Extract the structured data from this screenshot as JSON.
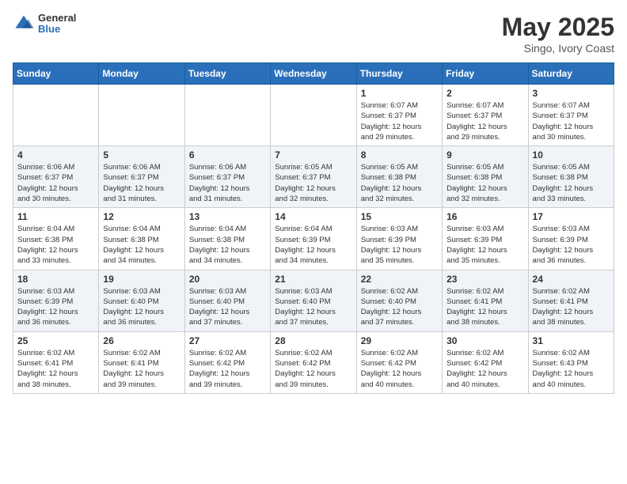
{
  "header": {
    "logo_general": "General",
    "logo_blue": "Blue",
    "month_year": "May 2025",
    "location": "Singo, Ivory Coast"
  },
  "days_of_week": [
    "Sunday",
    "Monday",
    "Tuesday",
    "Wednesday",
    "Thursday",
    "Friday",
    "Saturday"
  ],
  "weeks": [
    [
      {
        "day": "",
        "info": ""
      },
      {
        "day": "",
        "info": ""
      },
      {
        "day": "",
        "info": ""
      },
      {
        "day": "",
        "info": ""
      },
      {
        "day": "1",
        "info": "Sunrise: 6:07 AM\nSunset: 6:37 PM\nDaylight: 12 hours\nand 29 minutes."
      },
      {
        "day": "2",
        "info": "Sunrise: 6:07 AM\nSunset: 6:37 PM\nDaylight: 12 hours\nand 29 minutes."
      },
      {
        "day": "3",
        "info": "Sunrise: 6:07 AM\nSunset: 6:37 PM\nDaylight: 12 hours\nand 30 minutes."
      }
    ],
    [
      {
        "day": "4",
        "info": "Sunrise: 6:06 AM\nSunset: 6:37 PM\nDaylight: 12 hours\nand 30 minutes."
      },
      {
        "day": "5",
        "info": "Sunrise: 6:06 AM\nSunset: 6:37 PM\nDaylight: 12 hours\nand 31 minutes."
      },
      {
        "day": "6",
        "info": "Sunrise: 6:06 AM\nSunset: 6:37 PM\nDaylight: 12 hours\nand 31 minutes."
      },
      {
        "day": "7",
        "info": "Sunrise: 6:05 AM\nSunset: 6:37 PM\nDaylight: 12 hours\nand 32 minutes."
      },
      {
        "day": "8",
        "info": "Sunrise: 6:05 AM\nSunset: 6:38 PM\nDaylight: 12 hours\nand 32 minutes."
      },
      {
        "day": "9",
        "info": "Sunrise: 6:05 AM\nSunset: 6:38 PM\nDaylight: 12 hours\nand 32 minutes."
      },
      {
        "day": "10",
        "info": "Sunrise: 6:05 AM\nSunset: 6:38 PM\nDaylight: 12 hours\nand 33 minutes."
      }
    ],
    [
      {
        "day": "11",
        "info": "Sunrise: 6:04 AM\nSunset: 6:38 PM\nDaylight: 12 hours\nand 33 minutes."
      },
      {
        "day": "12",
        "info": "Sunrise: 6:04 AM\nSunset: 6:38 PM\nDaylight: 12 hours\nand 34 minutes."
      },
      {
        "day": "13",
        "info": "Sunrise: 6:04 AM\nSunset: 6:38 PM\nDaylight: 12 hours\nand 34 minutes."
      },
      {
        "day": "14",
        "info": "Sunrise: 6:04 AM\nSunset: 6:39 PM\nDaylight: 12 hours\nand 34 minutes."
      },
      {
        "day": "15",
        "info": "Sunrise: 6:03 AM\nSunset: 6:39 PM\nDaylight: 12 hours\nand 35 minutes."
      },
      {
        "day": "16",
        "info": "Sunrise: 6:03 AM\nSunset: 6:39 PM\nDaylight: 12 hours\nand 35 minutes."
      },
      {
        "day": "17",
        "info": "Sunrise: 6:03 AM\nSunset: 6:39 PM\nDaylight: 12 hours\nand 36 minutes."
      }
    ],
    [
      {
        "day": "18",
        "info": "Sunrise: 6:03 AM\nSunset: 6:39 PM\nDaylight: 12 hours\nand 36 minutes."
      },
      {
        "day": "19",
        "info": "Sunrise: 6:03 AM\nSunset: 6:40 PM\nDaylight: 12 hours\nand 36 minutes."
      },
      {
        "day": "20",
        "info": "Sunrise: 6:03 AM\nSunset: 6:40 PM\nDaylight: 12 hours\nand 37 minutes."
      },
      {
        "day": "21",
        "info": "Sunrise: 6:03 AM\nSunset: 6:40 PM\nDaylight: 12 hours\nand 37 minutes."
      },
      {
        "day": "22",
        "info": "Sunrise: 6:02 AM\nSunset: 6:40 PM\nDaylight: 12 hours\nand 37 minutes."
      },
      {
        "day": "23",
        "info": "Sunrise: 6:02 AM\nSunset: 6:41 PM\nDaylight: 12 hours\nand 38 minutes."
      },
      {
        "day": "24",
        "info": "Sunrise: 6:02 AM\nSunset: 6:41 PM\nDaylight: 12 hours\nand 38 minutes."
      }
    ],
    [
      {
        "day": "25",
        "info": "Sunrise: 6:02 AM\nSunset: 6:41 PM\nDaylight: 12 hours\nand 38 minutes."
      },
      {
        "day": "26",
        "info": "Sunrise: 6:02 AM\nSunset: 6:41 PM\nDaylight: 12 hours\nand 39 minutes."
      },
      {
        "day": "27",
        "info": "Sunrise: 6:02 AM\nSunset: 6:42 PM\nDaylight: 12 hours\nand 39 minutes."
      },
      {
        "day": "28",
        "info": "Sunrise: 6:02 AM\nSunset: 6:42 PM\nDaylight: 12 hours\nand 39 minutes."
      },
      {
        "day": "29",
        "info": "Sunrise: 6:02 AM\nSunset: 6:42 PM\nDaylight: 12 hours\nand 40 minutes."
      },
      {
        "day": "30",
        "info": "Sunrise: 6:02 AM\nSunset: 6:42 PM\nDaylight: 12 hours\nand 40 minutes."
      },
      {
        "day": "31",
        "info": "Sunrise: 6:02 AM\nSunset: 6:43 PM\nDaylight: 12 hours\nand 40 minutes."
      }
    ]
  ]
}
